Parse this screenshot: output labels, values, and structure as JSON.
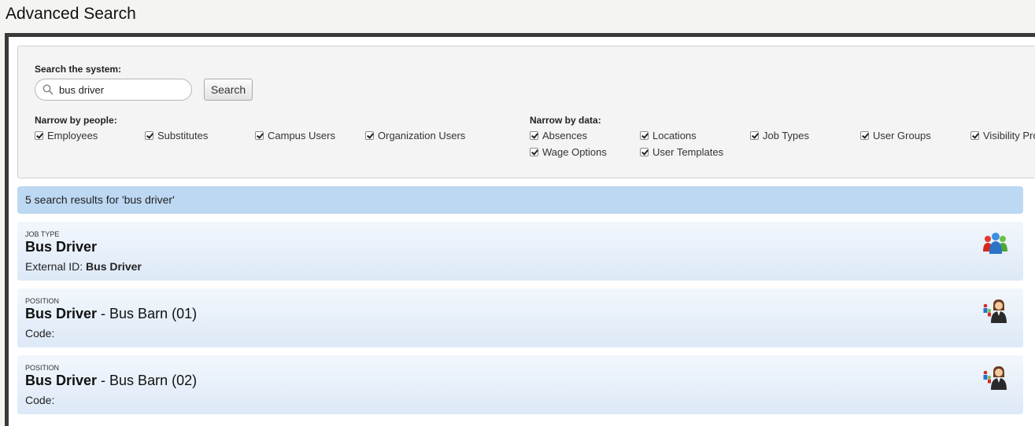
{
  "page": {
    "title": "Advanced Search"
  },
  "search": {
    "label": "Search the system:",
    "value": "bus driver",
    "button_label": "Search"
  },
  "filters": {
    "people_label": "Narrow by people:",
    "people": [
      {
        "label": "Employees",
        "checked": true
      },
      {
        "label": "Substitutes",
        "checked": true
      },
      {
        "label": "Campus Users",
        "checked": true
      },
      {
        "label": "Organization Users",
        "checked": true
      }
    ],
    "data_label": "Narrow by data:",
    "data": [
      {
        "label": "Absences",
        "checked": true
      },
      {
        "label": "Locations",
        "checked": true
      },
      {
        "label": "Job Types",
        "checked": true
      },
      {
        "label": "User Groups",
        "checked": true
      },
      {
        "label": "Visibility Pro",
        "checked": true
      },
      {
        "label": "Wage Options",
        "checked": true
      },
      {
        "label": "User Templates",
        "checked": true
      }
    ]
  },
  "results": {
    "summary": "5 search results for 'bus driver'",
    "items": [
      {
        "type": "JOB TYPE",
        "title": "Bus Driver",
        "subtitle": "",
        "meta_label": "External ID: ",
        "meta_value": "Bus Driver",
        "icon": "people-group-icon"
      },
      {
        "type": "POSITION",
        "title": "Bus Driver",
        "subtitle": " - Bus Barn (01)",
        "meta_label": "Code:",
        "meta_value": "",
        "icon": "position-person-icon"
      },
      {
        "type": "POSITION",
        "title": "Bus Driver",
        "subtitle": " - Bus Barn (02)",
        "meta_label": "Code:",
        "meta_value": "",
        "icon": "position-person-icon"
      }
    ]
  }
}
